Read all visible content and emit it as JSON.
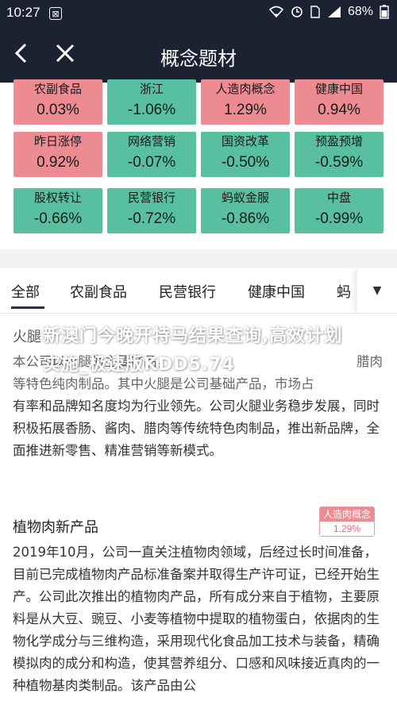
{
  "status": {
    "time": "10:27",
    "battery": "68%"
  },
  "nav": {
    "title": "概念题材"
  },
  "tiles": [
    {
      "name": "农副食品",
      "value": "0.03%",
      "dir": "up"
    },
    {
      "name": "浙江",
      "value": "-1.06%",
      "dir": "down"
    },
    {
      "name": "人造肉概念",
      "value": "1.29%",
      "dir": "up"
    },
    {
      "name": "健康中国",
      "value": "0.94%",
      "dir": "up"
    },
    {
      "name": "昨日涨停",
      "value": "0.92%",
      "dir": "up"
    },
    {
      "name": "网络营销",
      "value": "-0.07%",
      "dir": "down"
    },
    {
      "name": "国资改革",
      "value": "-0.50%",
      "dir": "down"
    },
    {
      "name": "预盈预增",
      "value": "-0.59%",
      "dir": "down"
    },
    {
      "name": "股权转让",
      "value": "-0.66%",
      "dir": "down"
    },
    {
      "name": "民营银行",
      "value": "-0.72%",
      "dir": "down"
    },
    {
      "name": "蚂蚁金服",
      "value": "-0.86%",
      "dir": "down"
    },
    {
      "name": "中盘",
      "value": "-0.99%",
      "dir": "down"
    }
  ],
  "tabs": [
    "全部",
    "农副食品",
    "民营银行",
    "健康中国",
    "蚂"
  ],
  "articles": [
    {
      "title": "火腿",
      "body_line1": "本公司以火腿为主要产品，",
      "body_line1_end": "腊肉",
      "body_line2": "等特色纯肉制品。",
      "body_line2_mid": "其中火腿是公司基础产品，市场占",
      "body_rest": "有率和品牌知名度均为行业领先。公司火腿业务稳步发展，同时积极拓展香肠、酱肉、腊肉等传统特色肉制品，推出新品牌，全面推进新零售、精准营销等新模式。"
    },
    {
      "title": "植物肉新产品",
      "tag": {
        "name": "人造肉概念",
        "value": "1.29%"
      },
      "body": "2019年10月，公司一直关注植物肉领域，后经过长时间准备，目前已完成植物肉产品标准备案并取得生产许可证，已经开始生产。公司此次推出的植物肉产品，所有成分来自于植物，主要原料是从大豆、豌豆、小麦等植物中提取的植物蛋白，依据肉的生物化学成分与三维构造，采用现代化食品加工技术与装备，精确模拟肉的成分和构造，使其营养组分、口感和风味接近真肉的一种植物基肉类制品。该产品由公"
    }
  ],
  "watermark": "新澳门今晚开特马结果查询,高效计划实施_极速版KDD5.74",
  "colors": {
    "up": "#ec8b92",
    "down": "#58bfa0",
    "header": "#1d2233"
  }
}
